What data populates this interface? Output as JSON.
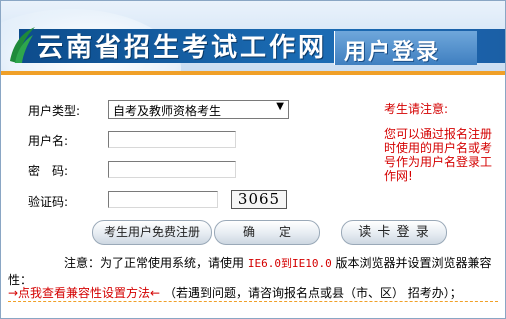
{
  "banner": {
    "title": "云南省招生考试工作网",
    "subtitle": "用户登录"
  },
  "form": {
    "user_type_label": "用户类型:",
    "user_type_value": "自考及教师资格考生",
    "username_label": "用户名:",
    "username_value": "",
    "password_label": "密　码:",
    "password_value": "",
    "captcha_label": "验证码:",
    "captcha_input_value": "",
    "captcha_image_text": "3065"
  },
  "buttons": {
    "register": "考生用户免费注册",
    "confirm": "确　　定",
    "card_login": "读 卡 登 录"
  },
  "hint": {
    "title": "考生请注意:",
    "body": "您可以通过报名注册时使用的用户名或考号作为用户名登录工作网!"
  },
  "notice": {
    "prefix": "注意：为了正常使用系统，请使用",
    "ie_range": "IE6.0到IE10.0",
    "suffix": "版本浏览器并设置浏览器兼容性："
  },
  "compat": {
    "link_text": "→点我查看兼容性设置方法←",
    "contact_text": "（若遇到问题，请咨询报名点或县（市、区） 招考办）；"
  },
  "colors": {
    "accent_red": "#d40000",
    "banner_blue": "#1b6cb4",
    "orange": "#f0a028"
  }
}
